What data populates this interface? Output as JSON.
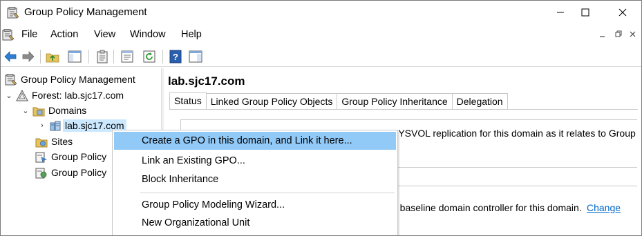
{
  "window": {
    "title": "Group Policy Management",
    "controls": [
      "minimize",
      "maximize",
      "close"
    ]
  },
  "menubar": {
    "items": [
      "File",
      "Action",
      "View",
      "Window",
      "Help"
    ]
  },
  "toolbar": {
    "buttons": [
      "back-arrow-icon",
      "forward-arrow-icon",
      "up-folder-icon",
      "show-hide-tree-icon",
      "clipboard-icon",
      "properties-icon",
      "refresh-icon",
      "help-icon",
      "show-hide-action-pane-icon"
    ]
  },
  "tree": {
    "root": "Group Policy Management",
    "forest": "Forest: lab.sjc17.com",
    "domains": "Domains",
    "domain": "lab.sjc17.com",
    "sites": "Sites",
    "gp_modeling": "Group Policy",
    "gp_results": "Group Policy"
  },
  "content": {
    "header": "lab.sjc17.com",
    "tabs": [
      "Status",
      "Linked Group Policy Objects",
      "Group Policy Inheritance",
      "Delegation"
    ],
    "info_text_visible": "SYSVOL replication for this domain as it relates to Group",
    "baseline_text": "e baseline domain controller for this domain.",
    "change_link": "Change"
  },
  "context_menu": {
    "items": [
      "Create a GPO in this domain, and Link it here...",
      "Link an Existing GPO...",
      "Block Inheritance",
      "Group Policy Modeling Wizard...",
      "New Organizational Unit"
    ],
    "highlighted_index": 0
  },
  "colors": {
    "menu_highlight": "#91c9f7",
    "tree_selection": "#cce8ff",
    "link": "#0066cc"
  }
}
